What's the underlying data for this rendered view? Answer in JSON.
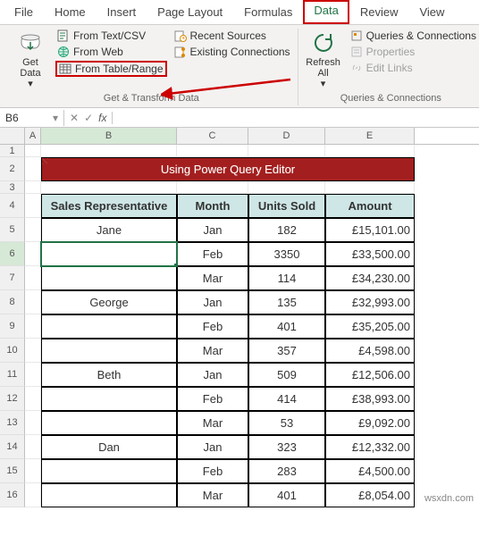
{
  "tabs": [
    "File",
    "Home",
    "Insert",
    "Page Layout",
    "Formulas",
    "Data",
    "Review",
    "View"
  ],
  "active_tab": "Data",
  "ribbon": {
    "get_data": {
      "label": "Get Data"
    },
    "from_text_csv": "From Text/CSV",
    "from_web": "From Web",
    "from_table_range": "From Table/Range",
    "recent_sources": "Recent Sources",
    "existing_connections": "Existing Connections",
    "group1_label": "Get & Transform Data",
    "refresh_all": {
      "label": "Refresh All"
    },
    "queries_connections": "Queries & Connections",
    "properties": "Properties",
    "edit_links": "Edit Links",
    "group2_label": "Queries & Connections"
  },
  "namebox": "B6",
  "formula": "",
  "col_letters": [
    "A",
    "B",
    "C",
    "D",
    "E"
  ],
  "title": "Using Power Query Editor",
  "table": {
    "headers": [
      "Sales Representative",
      "Month",
      "Units Sold",
      "Amount"
    ],
    "rows": [
      {
        "rep": "Jane",
        "month": "Jan",
        "units": "182",
        "amount": "£15,101.00"
      },
      {
        "rep": "",
        "month": "Feb",
        "units": "3350",
        "amount": "£33,500.00"
      },
      {
        "rep": "",
        "month": "Mar",
        "units": "114",
        "amount": "£34,230.00"
      },
      {
        "rep": "George",
        "month": "Jan",
        "units": "135",
        "amount": "£32,993.00"
      },
      {
        "rep": "",
        "month": "Feb",
        "units": "401",
        "amount": "£35,205.00"
      },
      {
        "rep": "",
        "month": "Mar",
        "units": "357",
        "amount": "£4,598.00"
      },
      {
        "rep": "Beth",
        "month": "Jan",
        "units": "509",
        "amount": "£12,506.00"
      },
      {
        "rep": "",
        "month": "Feb",
        "units": "414",
        "amount": "£38,993.00"
      },
      {
        "rep": "",
        "month": "Mar",
        "units": "53",
        "amount": "£9,092.00"
      },
      {
        "rep": "Dan",
        "month": "Jan",
        "units": "323",
        "amount": "£12,332.00"
      },
      {
        "rep": "",
        "month": "Feb",
        "units": "283",
        "amount": "£4,500.00"
      },
      {
        "rep": "",
        "month": "Mar",
        "units": "401",
        "amount": "£8,054.00"
      }
    ]
  },
  "selected_cell": "B6",
  "watermark": "wsxdn.com"
}
